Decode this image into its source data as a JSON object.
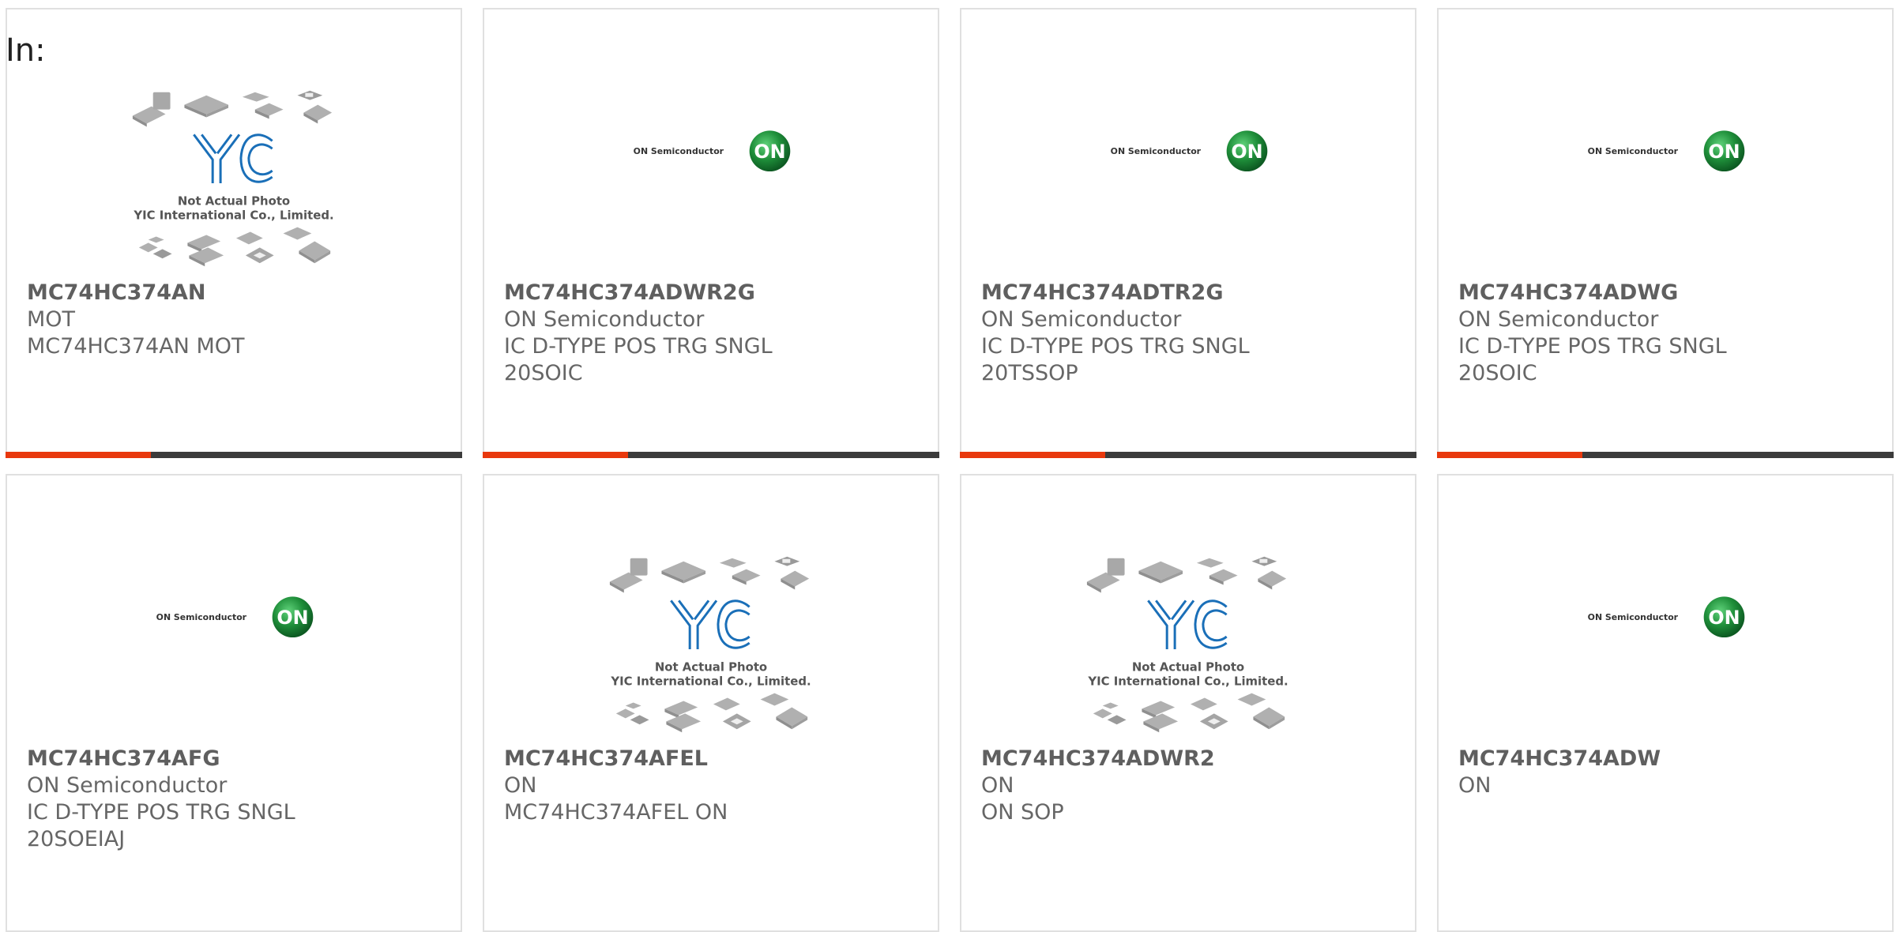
{
  "filter_label": "In:",
  "accent_color": "#e8380d",
  "bar_color": "#3b3b3b",
  "logo_green": "#1f8f3a",
  "placeholder": {
    "line1": "Not Actual Photo",
    "line2": "YIC International Co., Limited.",
    "brand": "YIC"
  },
  "on_logo": {
    "wordmark": "ON Semiconductor",
    "mark": "ON"
  },
  "products": [
    {
      "part": "MC74HC374AN",
      "manufacturer": "MOT",
      "description": "MC74HC374AN MOT",
      "image": "yic-placeholder-icon"
    },
    {
      "part": "MC74HC374ADWR2G",
      "manufacturer": "ON Semiconductor",
      "description": "IC D-TYPE POS TRG SNGL\n20SOIC",
      "image": "on-semiconductor-logo"
    },
    {
      "part": "MC74HC374ADTR2G",
      "manufacturer": "ON Semiconductor",
      "description": "IC D-TYPE POS TRG SNGL\n20TSSOP",
      "image": "on-semiconductor-logo"
    },
    {
      "part": "MC74HC374ADWG",
      "manufacturer": "ON Semiconductor",
      "description": "IC D-TYPE POS TRG SNGL\n20SOIC",
      "image": "on-semiconductor-logo"
    },
    {
      "part": "MC74HC374AFG",
      "manufacturer": "ON Semiconductor",
      "description": "IC D-TYPE POS TRG SNGL\n20SOEIAJ",
      "image": "on-semiconductor-logo"
    },
    {
      "part": "MC74HC374AFEL",
      "manufacturer": "ON",
      "description": "MC74HC374AFEL ON",
      "image": "yic-placeholder-icon"
    },
    {
      "part": "MC74HC374ADWR2",
      "manufacturer": "ON",
      "description": "ON SOP",
      "image": "yic-placeholder-icon"
    },
    {
      "part": "MC74HC374ADW",
      "manufacturer": "ON",
      "description": "",
      "image": "on-semiconductor-logo"
    }
  ]
}
